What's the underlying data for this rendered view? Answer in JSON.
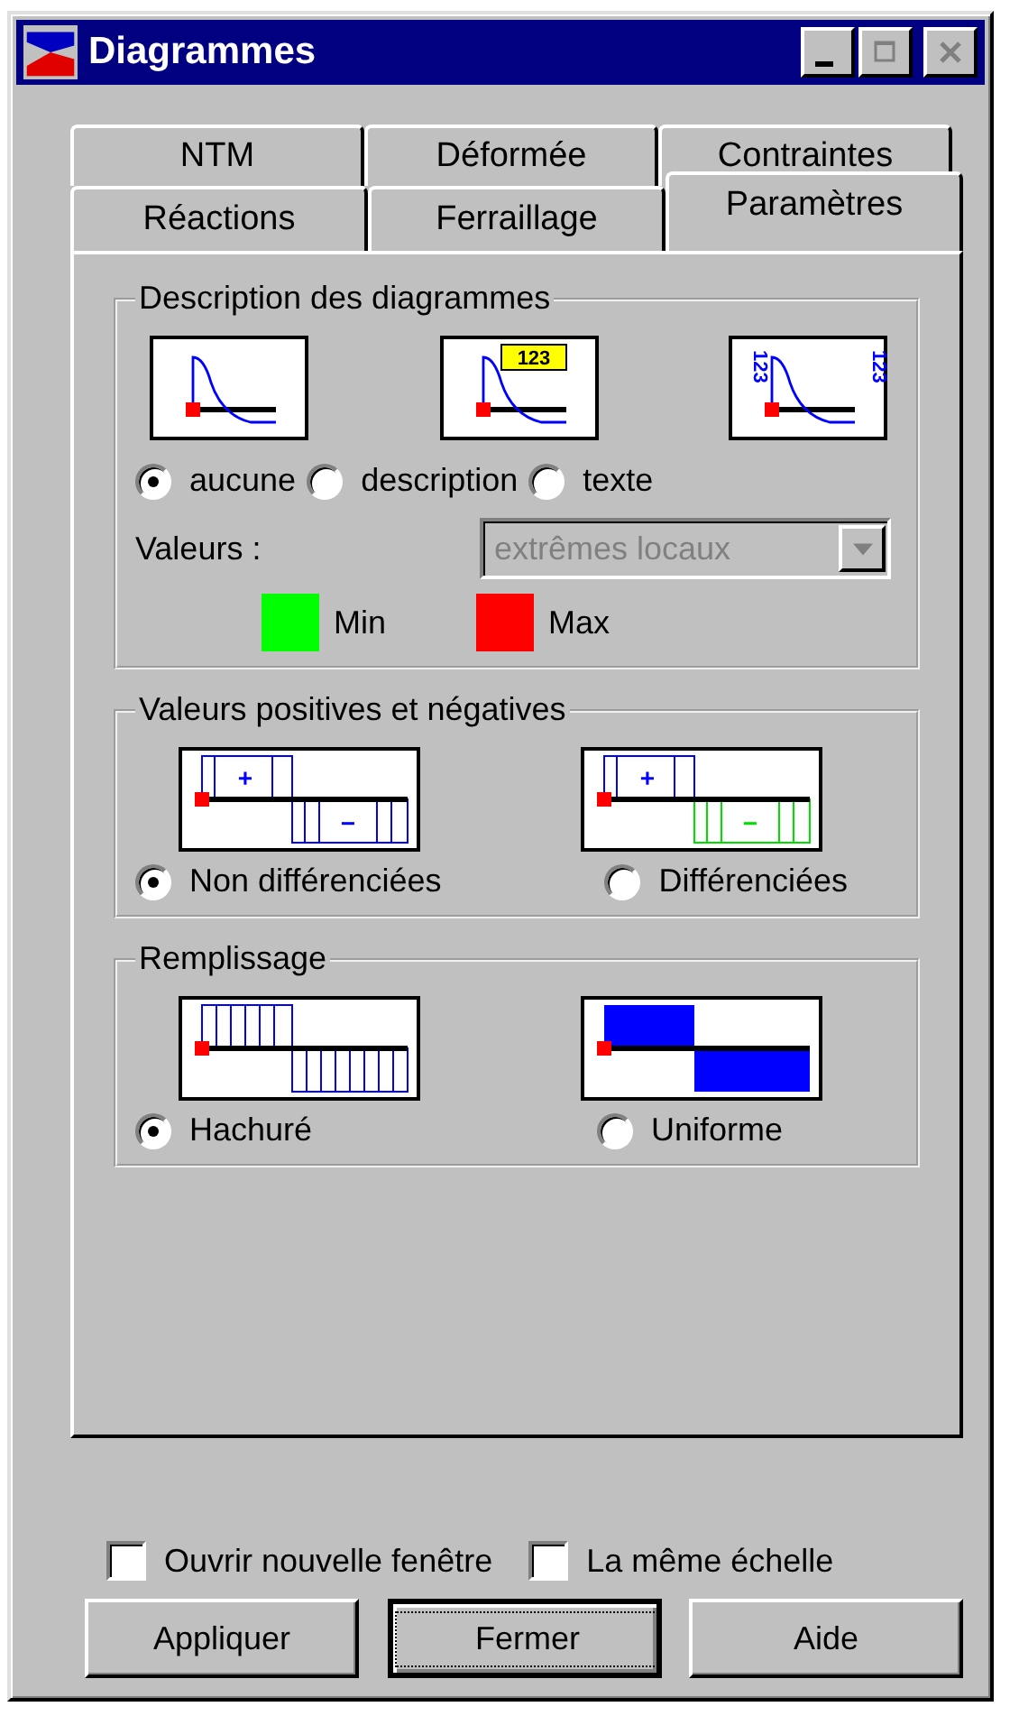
{
  "window": {
    "title": "Diagrammes"
  },
  "tabs_back_row": [
    {
      "label": "NTM",
      "selected": false
    },
    {
      "label": "Déformée",
      "selected": false
    },
    {
      "label": "Contraintes",
      "selected": false
    }
  ],
  "tabs_front_row": [
    {
      "label": "Réactions",
      "selected": false
    },
    {
      "label": "Ferraillage",
      "selected": false
    },
    {
      "label": "Paramètres",
      "selected": true
    }
  ],
  "description_group": {
    "title": "Description des diagrammes",
    "previews": [
      {
        "kind": "plain"
      },
      {
        "kind": "badge",
        "labels": [
          "123"
        ]
      },
      {
        "kind": "side",
        "labels": [
          "123",
          "123"
        ]
      }
    ],
    "options": [
      {
        "label": "aucune",
        "selected": true
      },
      {
        "label": "description",
        "selected": false
      },
      {
        "label": "texte",
        "selected": false
      }
    ],
    "values_label": "Valeurs :",
    "values_dropdown": {
      "value": "extrêmes locaux",
      "disabled": true
    },
    "legend": [
      {
        "label": "Min",
        "color": "#00ff00"
      },
      {
        "label": "Max",
        "color": "#ff0000"
      }
    ]
  },
  "sign_group": {
    "title": "Valeurs positives et négatives",
    "previews": [
      {
        "kind": "same",
        "plus": "+",
        "minus": "−"
      },
      {
        "kind": "split",
        "plus": "+",
        "minus": "−"
      }
    ],
    "options": [
      {
        "label": "Non différenciées",
        "selected": true
      },
      {
        "label": "Différenciées",
        "selected": false
      }
    ]
  },
  "fill_group": {
    "title": "Remplissage",
    "previews": [
      {
        "kind": "hatched"
      },
      {
        "kind": "solid"
      }
    ],
    "options": [
      {
        "label": "Hachuré",
        "selected": true
      },
      {
        "label": "Uniforme",
        "selected": false
      }
    ]
  },
  "checkboxes": [
    {
      "label": "Ouvrir nouvelle fenêtre",
      "checked": false
    },
    {
      "label": "La même échelle",
      "checked": false
    }
  ],
  "buttons": [
    {
      "label": "Appliquer",
      "focused": false
    },
    {
      "label": "Fermer",
      "focused": true
    },
    {
      "label": "Aide",
      "focused": false
    }
  ]
}
